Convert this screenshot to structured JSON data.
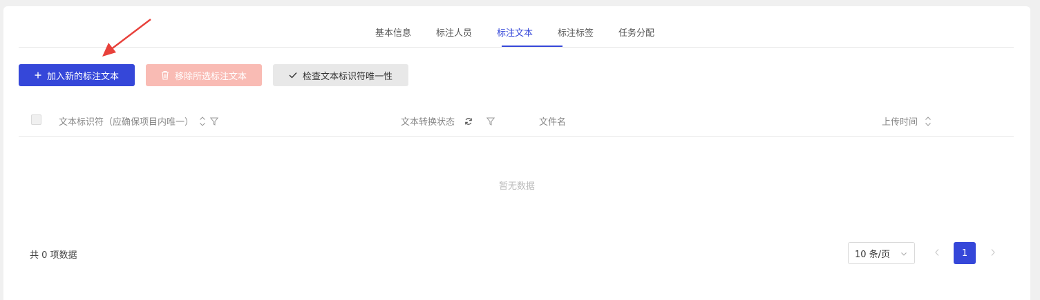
{
  "tabs": [
    {
      "label": "基本信息"
    },
    {
      "label": "标注人员"
    },
    {
      "label": "标注文本"
    },
    {
      "label": "标注标签"
    },
    {
      "label": "任务分配"
    }
  ],
  "active_tab": "标注文本",
  "toolbar": {
    "add_label": "加入新的标注文本",
    "remove_label": "移除所选标注文本",
    "check_label": "检查文本标识符唯一性"
  },
  "table": {
    "columns": [
      {
        "label": "文本标识符（应确保项目内唯一）"
      },
      {
        "label": "文本转换状态"
      },
      {
        "label": "文件名"
      },
      {
        "label": "上传时间"
      }
    ],
    "empty_text": "暂无数据"
  },
  "pagination": {
    "total_text": "共 0 项数据",
    "page_size": "10 条/页",
    "current_page": "1"
  },
  "colors": {
    "primary": "#3547d9",
    "danger_disabled": "#f9bbb4",
    "annotation_arrow": "#e8413b"
  }
}
